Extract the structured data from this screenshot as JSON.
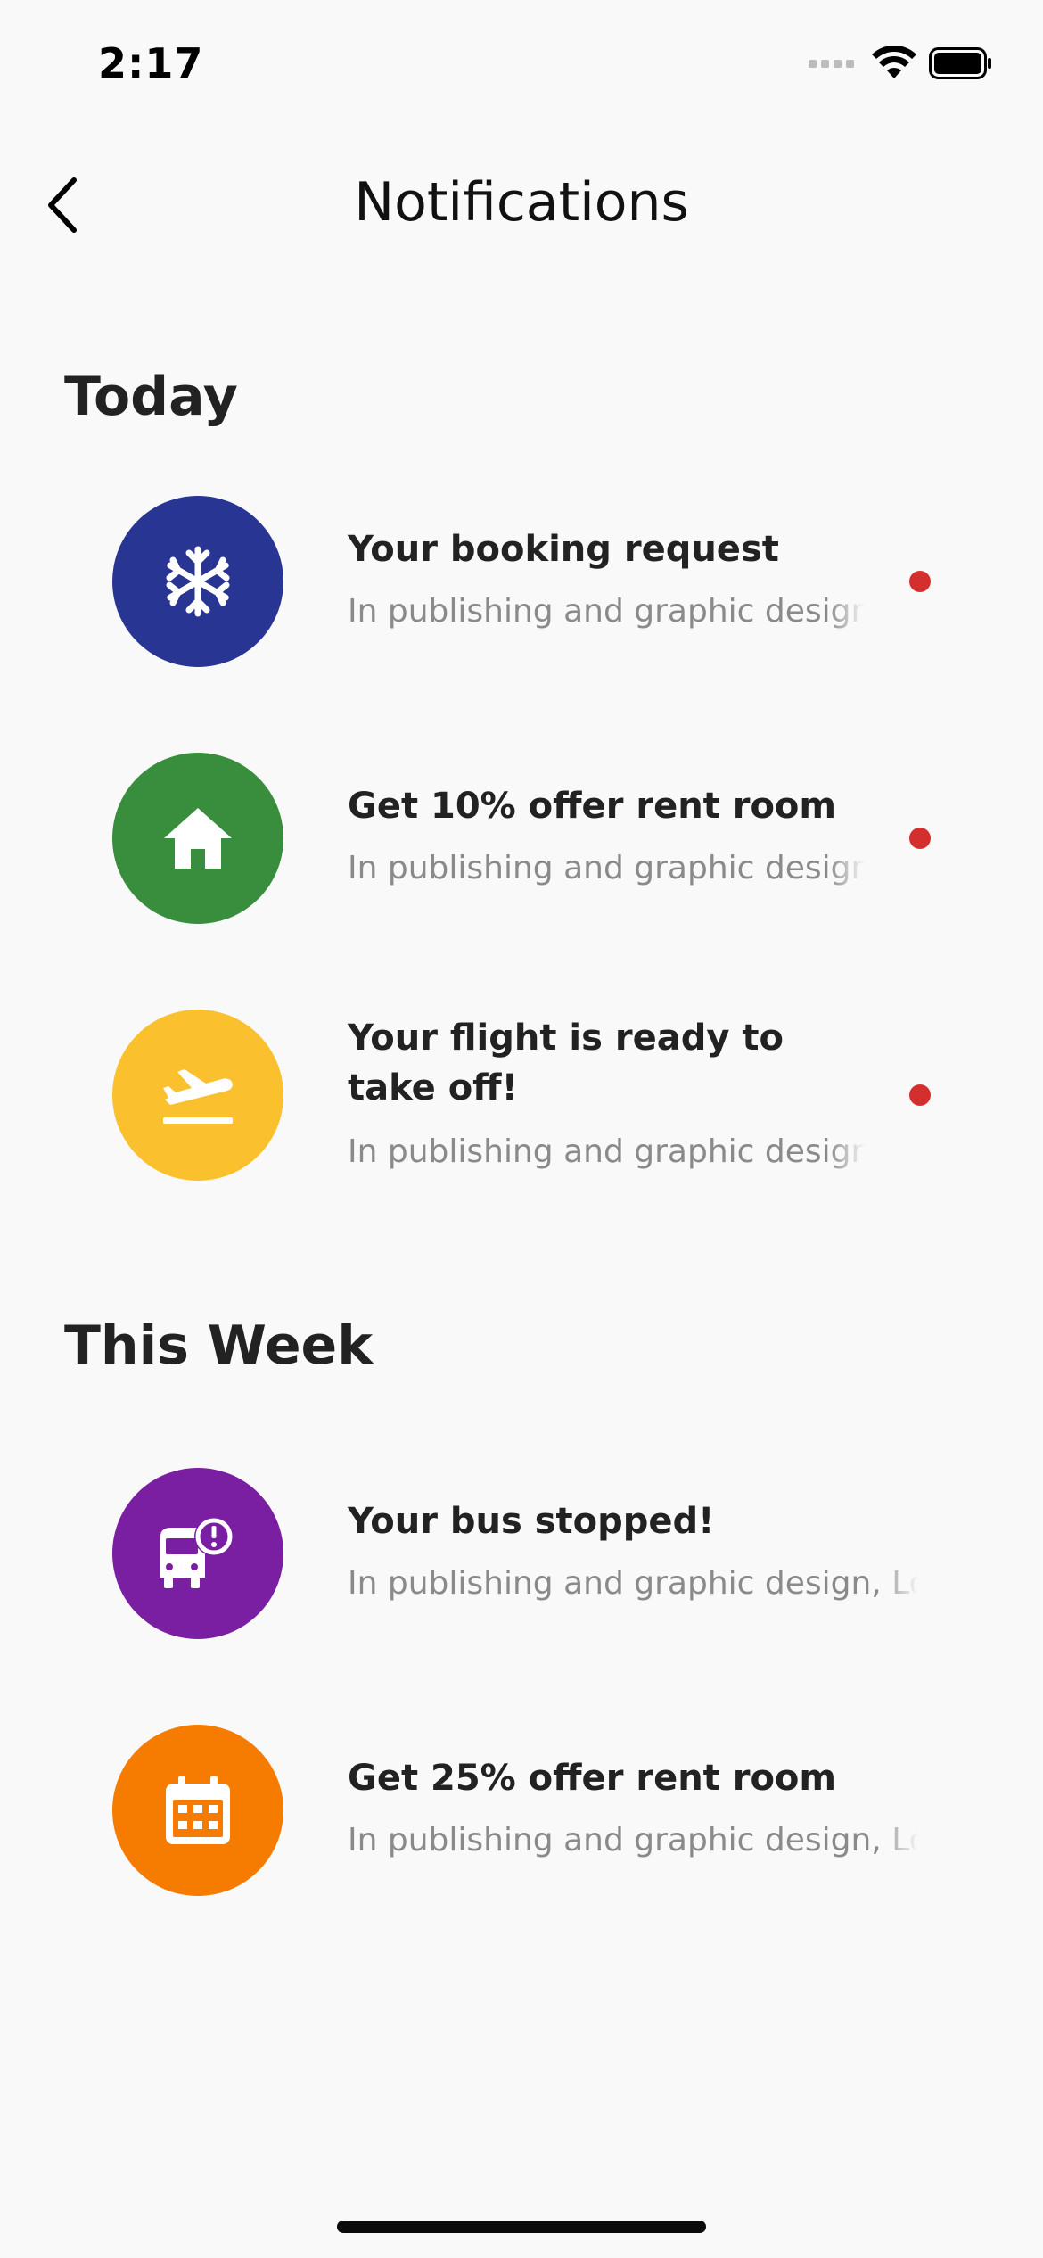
{
  "status_bar": {
    "time": "2:17",
    "icons": [
      "signal-icon",
      "wifi-icon",
      "battery-icon"
    ]
  },
  "header": {
    "title": "Notifications",
    "back_icon": "chevron-left-icon"
  },
  "sections": [
    {
      "title": "Today",
      "items": [
        {
          "title": "Your booking request",
          "subtitle": "In publishing and graphic design, Lorem ipsum",
          "icon": "snowflake-icon",
          "color": "#283593",
          "unread": true
        },
        {
          "title": "Get 10% offer rent room",
          "subtitle": "In publishing and graphic design, Lorem ipsum",
          "icon": "house-icon",
          "color": "#388e3c",
          "unread": true
        },
        {
          "title": "Your flight is ready to take off!",
          "subtitle": "In publishing and graphic design, Lorem ipsum",
          "icon": "flight-takeoff-icon",
          "color": "#fbc02d",
          "unread": true
        }
      ]
    },
    {
      "title": "This Week",
      "items": [
        {
          "title": "Your bus stopped!",
          "subtitle": "In publishing and graphic design, Lorem ipsum",
          "icon": "bus-alert-icon",
          "color": "#7b1fa2",
          "unread": false
        },
        {
          "title": "Get 25% offer rent room",
          "subtitle": "In publishing and graphic design, Lorem ipsum",
          "icon": "calendar-icon",
          "color": "#f57c00",
          "unread": false
        }
      ]
    }
  ],
  "colors": {
    "background": "#f9f9f9",
    "unread_dot": "#d32f2f",
    "subtitle": "#8a8a8a"
  }
}
